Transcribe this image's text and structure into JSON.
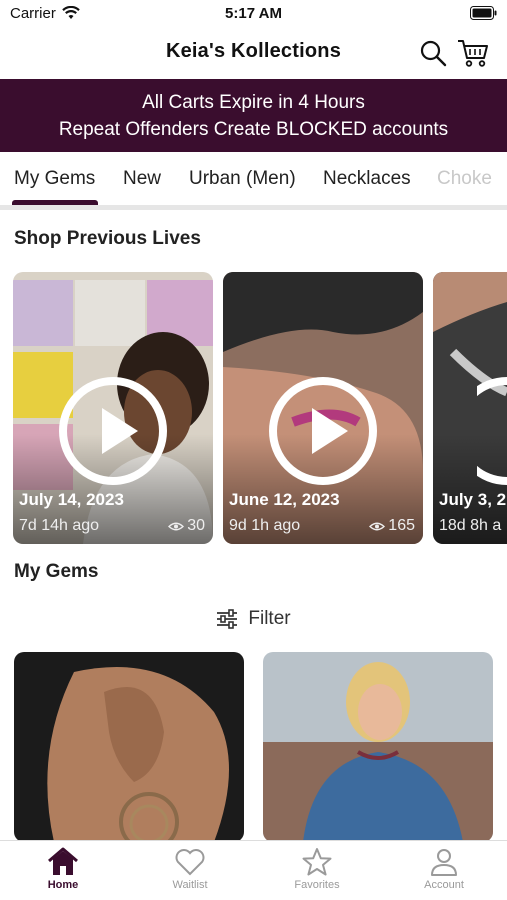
{
  "status": {
    "carrier": "Carrier",
    "time": "5:17 AM"
  },
  "header": {
    "title": "Keia's Kollections"
  },
  "banner": {
    "line1": "All Carts Expire in 4 Hours",
    "line2": "Repeat Offenders Create BLOCKED accounts"
  },
  "tabs": [
    {
      "label": "My Gems",
      "active": true
    },
    {
      "label": "New"
    },
    {
      "label": "Urban (Men)"
    },
    {
      "label": "Necklaces"
    },
    {
      "label": "Choke"
    }
  ],
  "sections": {
    "shop_previous_lives": "Shop Previous Lives",
    "my_gems": "My Gems"
  },
  "lives": [
    {
      "date": "July 14, 2023",
      "ago": "7d 14h ago",
      "views": "30"
    },
    {
      "date": "June 12, 2023",
      "ago": "9d 1h ago",
      "views": "165"
    },
    {
      "date": "July 3, 2",
      "ago": "18d 8h a",
      "views": ""
    }
  ],
  "filter": {
    "label": "Filter"
  },
  "nav": [
    {
      "label": "Home",
      "icon": "home-icon",
      "active": true
    },
    {
      "label": "Waitlist",
      "icon": "heart-icon"
    },
    {
      "label": "Favorites",
      "icon": "star-icon"
    },
    {
      "label": "Account",
      "icon": "person-icon"
    }
  ],
  "colors": {
    "brand": "#3a0d2e",
    "inactive": "#9a9a9a"
  }
}
